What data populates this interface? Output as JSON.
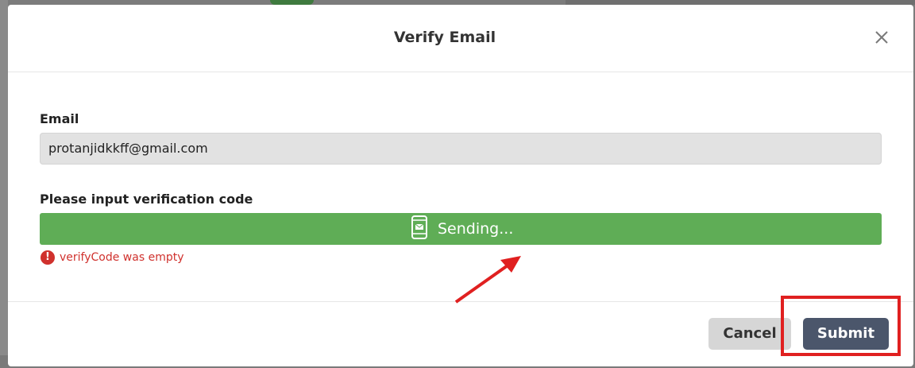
{
  "dialog": {
    "title": "Verify Email",
    "close_icon": "close-icon"
  },
  "form": {
    "email_label": "Email",
    "email_value": "protanjidkkff@gmail.com",
    "code_label": "Please input verification code",
    "send_button_label": "Sending...",
    "send_button_icon": "mobile-mail-icon",
    "error_icon": "exclamation-icon",
    "error_text": "verifyCode was empty"
  },
  "footer": {
    "cancel_label": "Cancel",
    "submit_label": "Submit"
  },
  "colors": {
    "send_button": "#5fad56",
    "submit_button": "#4b566b",
    "cancel_button": "#d6d6d6",
    "error": "#d0312d",
    "annotation": "#e02020"
  }
}
